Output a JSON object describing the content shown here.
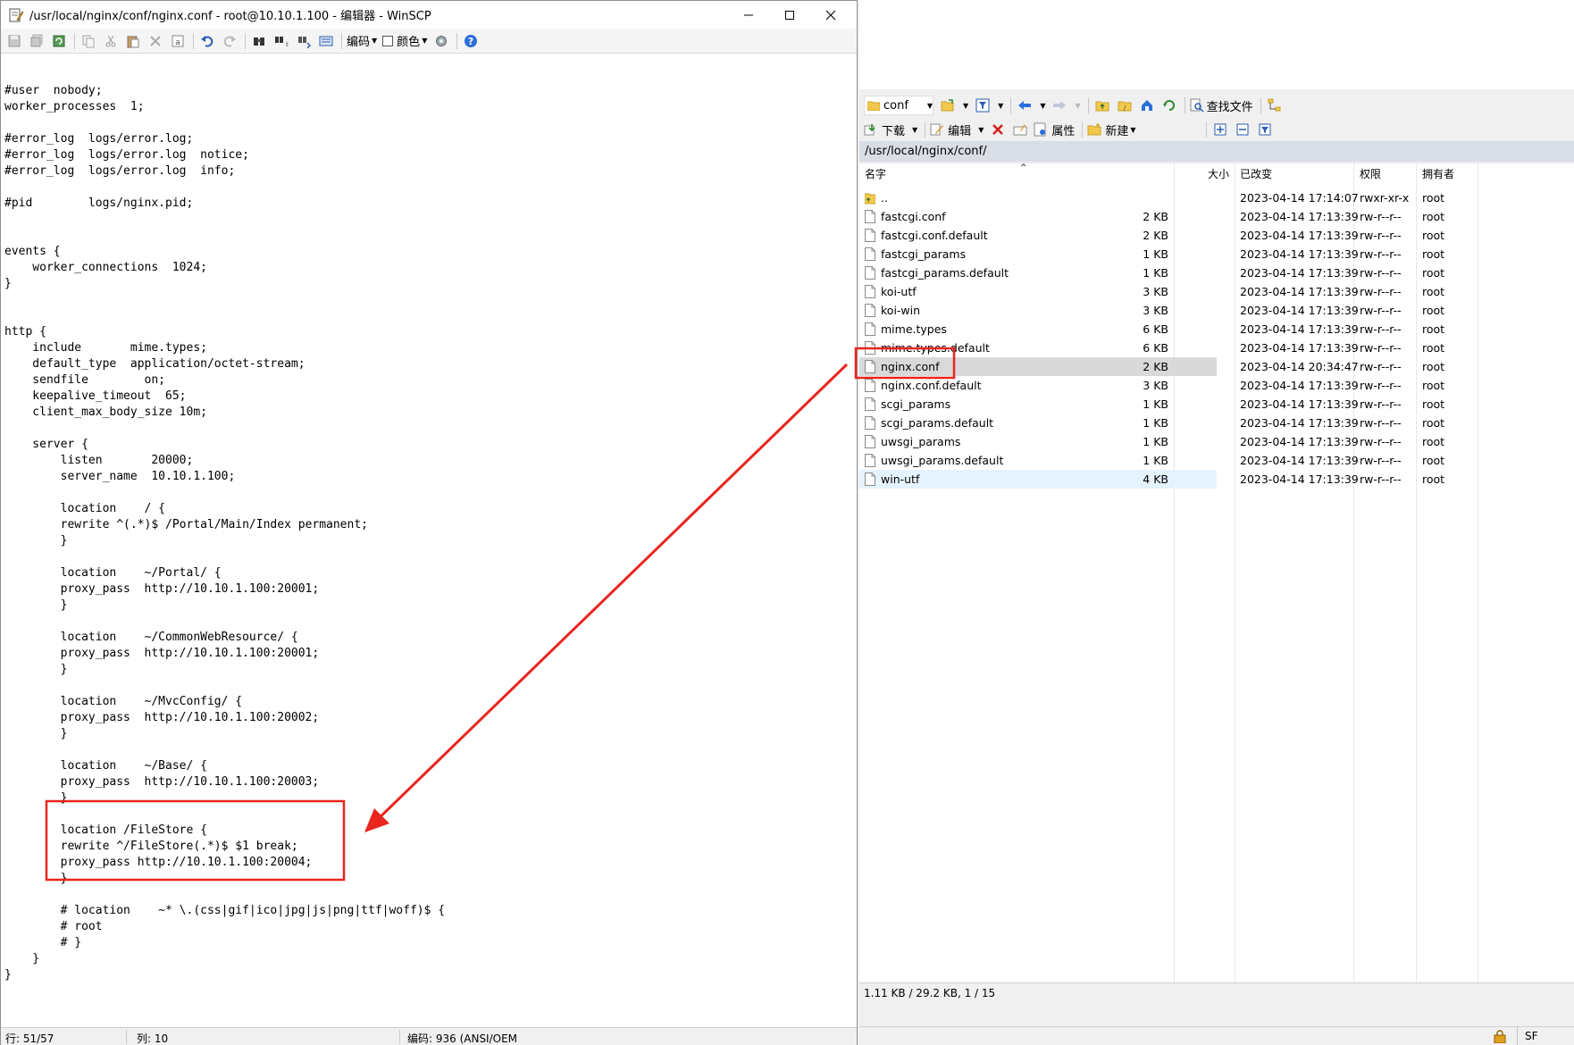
{
  "editor": {
    "title": "/usr/local/nginx/conf/nginx.conf - root@10.10.1.100 - 编辑器 - WinSCP",
    "toolbar": {
      "encoding_label": "编码",
      "color_label": "颜色"
    },
    "code_lines": [
      "",
      "#user  nobody;",
      "worker_processes  1;",
      "",
      "#error_log  logs/error.log;",
      "#error_log  logs/error.log  notice;",
      "#error_log  logs/error.log  info;",
      "",
      "#pid        logs/nginx.pid;",
      "",
      "",
      "events {",
      "    worker_connections  1024;",
      "}",
      "",
      "",
      "http {",
      "    include       mime.types;",
      "    default_type  application/octet-stream;",
      "    sendfile        on;",
      "    keepalive_timeout  65;",
      "    client_max_body_size 10m;",
      "",
      "    server {",
      "        listen       20000;",
      "        server_name  10.10.1.100;",
      "",
      "        location    / {",
      "        rewrite ^(.*)$ /Portal/Main/Index permanent;",
      "        }",
      "",
      "        location    ~/Portal/ {",
      "        proxy_pass  http://10.10.1.100:20001;",
      "        }",
      "",
      "        location    ~/CommonWebResource/ {",
      "        proxy_pass  http://10.10.1.100:20001;",
      "        }",
      "",
      "        location    ~/MvcConfig/ {",
      "        proxy_pass  http://10.10.1.100:20002;",
      "        }",
      "",
      "        location    ~/Base/ {",
      "        proxy_pass  http://10.10.1.100:20003;",
      "        }",
      "",
      "        location /FileStore {",
      "        rewrite ^/FileStore(.*)$ $1 break;",
      "        proxy_pass http://10.10.1.100:20004;",
      "        }",
      "",
      "        # location    ~* \\.(css|gif|ico|jpg|js|png|ttf|woff)$ {",
      "        # root",
      "        # }",
      "    }",
      "}"
    ],
    "status": {
      "line": "行: 51/57",
      "col": "列: 10",
      "encoding": "编码:  936  (ANSI/OEM"
    }
  },
  "panel": {
    "folder": "conf",
    "find_files": "查找文件",
    "download": "下载",
    "edit": "编辑",
    "properties": "属性",
    "new": "新建",
    "path": "/usr/local/nginx/conf/",
    "columns": {
      "name": "名字",
      "size": "大小",
      "modified": "已改变",
      "rights": "权限",
      "owner": "拥有者"
    },
    "files": [
      {
        "name": "..",
        "size": "",
        "modified": "2023-04-14 17:14:07",
        "rights": "rwxr-xr-x",
        "owner": "root",
        "parent": true
      },
      {
        "name": "fastcgi.conf",
        "size": "2 KB",
        "modified": "2023-04-14 17:13:39",
        "rights": "rw-r--r--",
        "owner": "root"
      },
      {
        "name": "fastcgi.conf.default",
        "size": "2 KB",
        "modified": "2023-04-14 17:13:39",
        "rights": "rw-r--r--",
        "owner": "root"
      },
      {
        "name": "fastcgi_params",
        "size": "1 KB",
        "modified": "2023-04-14 17:13:39",
        "rights": "rw-r--r--",
        "owner": "root"
      },
      {
        "name": "fastcgi_params.default",
        "size": "1 KB",
        "modified": "2023-04-14 17:13:39",
        "rights": "rw-r--r--",
        "owner": "root"
      },
      {
        "name": "koi-utf",
        "size": "3 KB",
        "modified": "2023-04-14 17:13:39",
        "rights": "rw-r--r--",
        "owner": "root"
      },
      {
        "name": "koi-win",
        "size": "3 KB",
        "modified": "2023-04-14 17:13:39",
        "rights": "rw-r--r--",
        "owner": "root"
      },
      {
        "name": "mime.types",
        "size": "6 KB",
        "modified": "2023-04-14 17:13:39",
        "rights": "rw-r--r--",
        "owner": "root"
      },
      {
        "name": "mime.types.default",
        "size": "6 KB",
        "modified": "2023-04-14 17:13:39",
        "rights": "rw-r--r--",
        "owner": "root"
      },
      {
        "name": "nginx.conf",
        "size": "2 KB",
        "modified": "2023-04-14 20:34:47",
        "rights": "rw-r--r--",
        "owner": "root",
        "selected": true
      },
      {
        "name": "nginx.conf.default",
        "size": "3 KB",
        "modified": "2023-04-14 17:13:39",
        "rights": "rw-r--r--",
        "owner": "root"
      },
      {
        "name": "scgi_params",
        "size": "1 KB",
        "modified": "2023-04-14 17:13:39",
        "rights": "rw-r--r--",
        "owner": "root"
      },
      {
        "name": "scgi_params.default",
        "size": "1 KB",
        "modified": "2023-04-14 17:13:39",
        "rights": "rw-r--r--",
        "owner": "root"
      },
      {
        "name": "uwsgi_params",
        "size": "1 KB",
        "modified": "2023-04-14 17:13:39",
        "rights": "rw-r--r--",
        "owner": "root"
      },
      {
        "name": "uwsgi_params.default",
        "size": "1 KB",
        "modified": "2023-04-14 17:13:39",
        "rights": "rw-r--r--",
        "owner": "root"
      },
      {
        "name": "win-utf",
        "size": "4 KB",
        "modified": "2023-04-14 17:13:39",
        "rights": "rw-r--r--",
        "owner": "root",
        "hover": true
      }
    ],
    "status": "1.11 KB / 29.2 KB,    1 / 15",
    "bottom_right": "SF"
  },
  "colors": {
    "annotation": "#e8251e",
    "selected_row": "#d9d9d9",
    "hover_row": "#e5f3ff",
    "path_bar": "#d9dde6",
    "help_icon": "#2a6fdb"
  }
}
